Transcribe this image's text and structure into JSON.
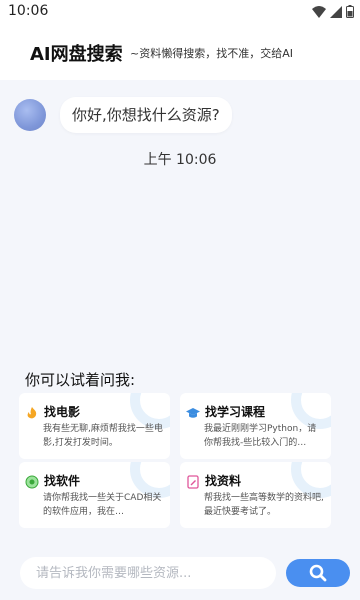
{
  "status_bar": {
    "time": "10:06"
  },
  "header": {
    "title": "AI网盘搜索",
    "subtitle": "~资料懒得搜索，找不准，交给AI"
  },
  "chat": {
    "bot_message": "你好,你想找什么资源?",
    "time": "上午 10:06"
  },
  "suggestions": {
    "title": "你可以试着问我:",
    "cards": [
      {
        "title": "找电影",
        "desc": "我有些无聊,麻烦帮我找一些电影,打发打发时间。",
        "icon": "movie-icon"
      },
      {
        "title": "找学习课程",
        "desc": "我最近刚刚学习Python，请你帮我找-些比较入门的…",
        "icon": "course-icon"
      },
      {
        "title": "找软件",
        "desc": "请你帮我找一些关于CAD相关的软件应用，我在…",
        "icon": "software-icon"
      },
      {
        "title": "找资料",
        "desc": "帮我找一些高等数学的资料吧,最近快要考试了。",
        "icon": "document-icon"
      }
    ]
  },
  "input": {
    "placeholder": "请告诉我你需要哪些资源..."
  },
  "colors": {
    "accent": "#4a8ff0",
    "background": "#f4f6fb"
  }
}
